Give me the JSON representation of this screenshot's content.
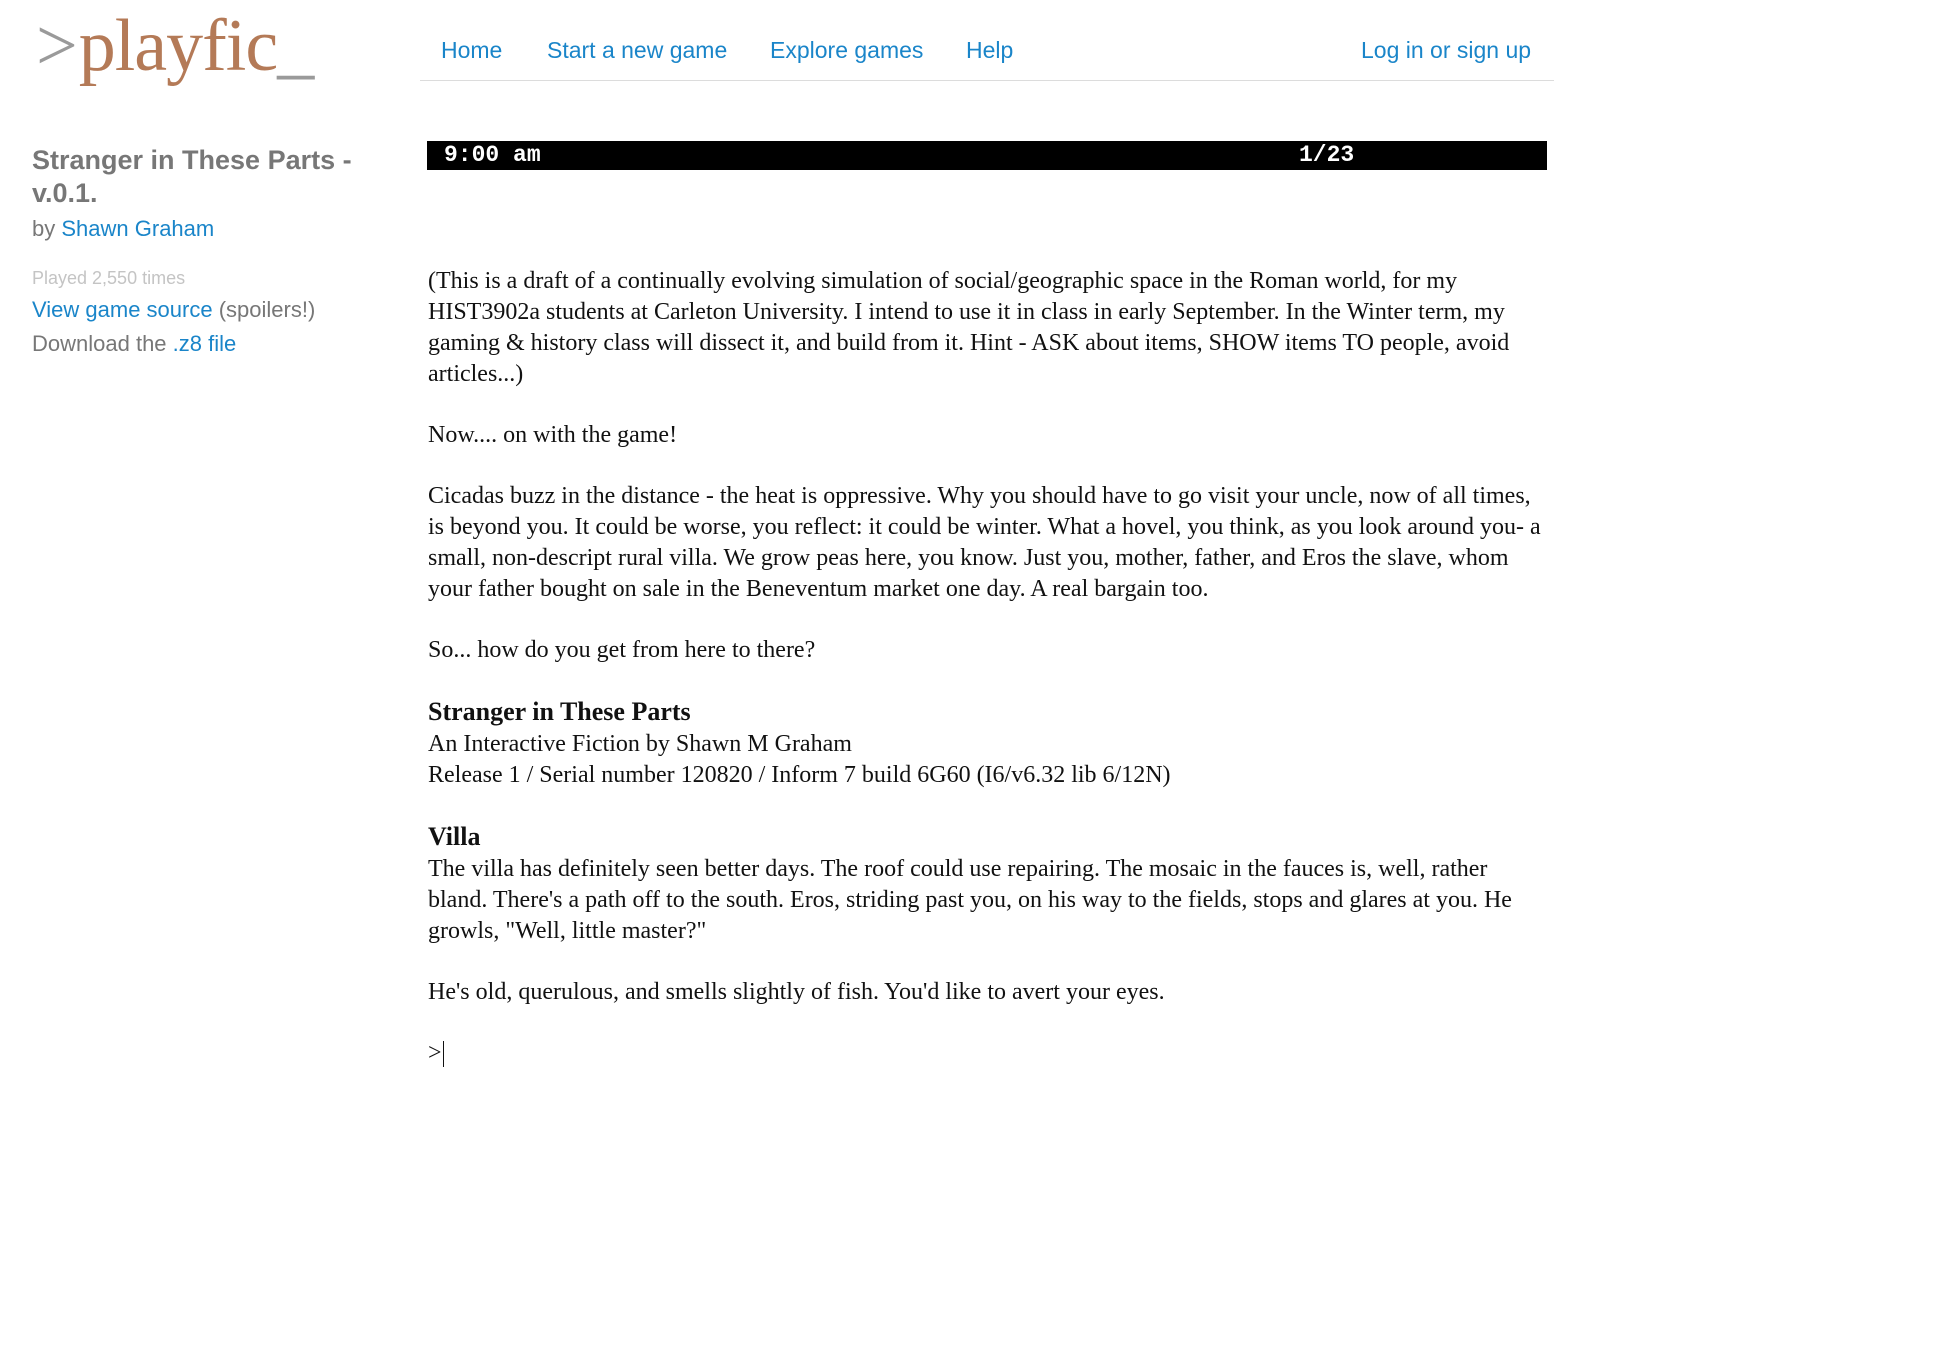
{
  "logo": {
    "prompt": ">",
    "word": "playfic",
    "cursor": "_"
  },
  "nav": {
    "home": "Home",
    "new_game": "Start a new game",
    "explore": "Explore games",
    "help": "Help",
    "login": "Log in or sign up"
  },
  "game": {
    "title": "Stranger in These Parts - v.0.1.",
    "by_prefix": "by",
    "author": "Shawn Graham",
    "played": "Played 2,550 times",
    "view_source": "View game source",
    "spoilers": "(spoilers!)",
    "download_prefix": "Download the",
    "download_link": ".z8 file"
  },
  "status": {
    "time": "9:00 am",
    "score": "1/23"
  },
  "transcript": {
    "intro": "(This is a draft of a continually evolving simulation of social/geographic space in the Roman world, for my HIST3902a students at Carleton University. I intend to use it in class in early September. In the Winter term, my gaming & history class will dissect it, and build from it. Hint - ASK about items, SHOW items TO people, avoid articles...)",
    "now": "Now.... on with the game!",
    "cicadas": "Cicadas buzz in the distance - the heat is oppressive. Why you should have to go visit your uncle, now of all times, is beyond you. It could be worse, you reflect: it could be winter. What a hovel, you think, as you look around you- a small, non-descript rural villa. We grow peas here, you know. Just you, mother, father, and Eros the slave, whom your father bought on sale in the Beneventum market one day. A real bargain too.",
    "so": "So... how do you get from here to there?",
    "story_title": "Stranger in These Parts",
    "story_subtitle": "An Interactive Fiction by Shawn M Graham",
    "release": "Release 1 / Serial number 120820 / Inform 7 build 6G60 (I6/v6.32 lib 6/12N)",
    "room_name": "Villa",
    "room_desc": "The villa has definitely seen better days. The roof could use repairing. The mosaic in the fauces is, well, rather bland. There's a path off to the south. Eros, striding past you, on his way to the fields, stops and glares at you. He growls, \"Well, little master?\"",
    "eros": "He's old, querulous, and smells slightly of fish. You'd like to avert your eyes.",
    "prompt": ">"
  }
}
